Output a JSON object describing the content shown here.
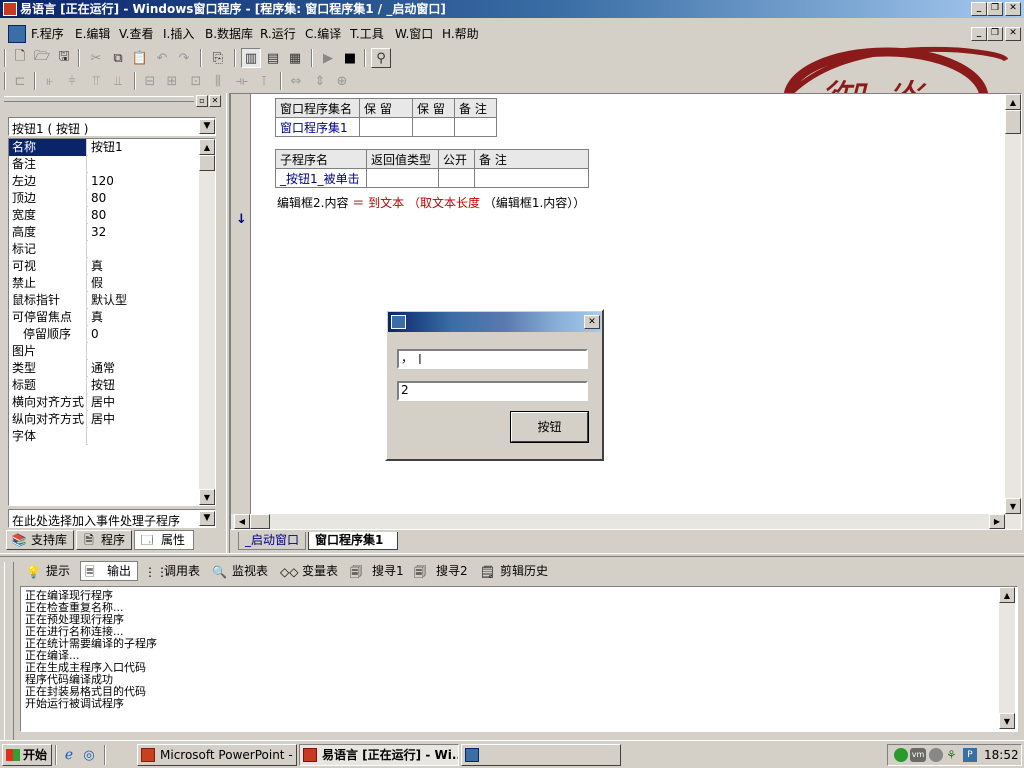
{
  "window": {
    "title": "易语言 [正在运行] - Windows窗口程序 - [程序集: 窗口程序集1 / _启动窗口]"
  },
  "menu": [
    {
      "key": "F",
      "label": "F.程序"
    },
    {
      "key": "E",
      "label": "E.编辑"
    },
    {
      "key": "V",
      "label": "V.查看"
    },
    {
      "key": "I",
      "label": "I.插入"
    },
    {
      "key": "B",
      "label": "B.数据库"
    },
    {
      "key": "R",
      "label": "R.运行"
    },
    {
      "key": "C",
      "label": "C.编译"
    },
    {
      "key": "T",
      "label": "T.工具"
    },
    {
      "key": "W",
      "label": "W.窗口"
    },
    {
      "key": "H",
      "label": "H.帮助"
    }
  ],
  "logo": {
    "text": "御焱",
    "color": "#8b1a1a"
  },
  "properties": {
    "selector": "按钮1 ( 按钮 )",
    "rows": [
      {
        "name": "名称",
        "value": "按钮1"
      },
      {
        "name": "备注",
        "value": ""
      },
      {
        "name": "左边",
        "value": "120"
      },
      {
        "name": "顶边",
        "value": "80"
      },
      {
        "name": "宽度",
        "value": "80"
      },
      {
        "name": "高度",
        "value": "32"
      },
      {
        "name": "标记",
        "value": ""
      },
      {
        "name": "可视",
        "value": "真"
      },
      {
        "name": "禁止",
        "value": "假"
      },
      {
        "name": "鼠标指针",
        "value": "默认型"
      },
      {
        "name": "可停留焦点",
        "value": "真"
      },
      {
        "name": "停留顺序",
        "value": "0"
      },
      {
        "name": "图片",
        "value": ""
      },
      {
        "name": "类型",
        "value": "通常"
      },
      {
        "name": "标题",
        "value": "按钮"
      },
      {
        "name": "横向对齐方式",
        "value": "居中"
      },
      {
        "name": "纵向对齐方式",
        "value": "居中"
      },
      {
        "name": "字体",
        "value": ""
      }
    ],
    "event_selector": "在此处选择加入事件处理子程序"
  },
  "left_tabs": [
    "支持库",
    "程序",
    "属性"
  ],
  "code": {
    "assembly_headers": [
      "窗口程序集名",
      "保 留",
      "保 留",
      "备 注"
    ],
    "assembly_row": [
      "窗口程序集1",
      "",
      "",
      ""
    ],
    "sub_headers": [
      "子程序名",
      "返回值类型",
      "公开",
      "备 注"
    ],
    "sub_row": [
      "_按钮1_被单击",
      "",
      "",
      ""
    ],
    "statement": {
      "target": "编辑框2.内容",
      "op": "＝",
      "func": "到文本",
      "open": "（",
      "inner": "取文本长度",
      "arg": "（编辑框1.内容））"
    }
  },
  "editor_tabs": [
    "_启动窗口",
    "窗口程序集1"
  ],
  "runtime_dialog": {
    "edit1_value": "，",
    "edit2_value": "2",
    "button_label": "按钮"
  },
  "output_tabs": [
    "提示",
    "输出",
    "调用表",
    "监视表",
    "变量表",
    "搜寻1",
    "搜寻2",
    "剪辑历史"
  ],
  "output_lines": [
    "正在编译现行程序",
    "正在检查重复名称...",
    "正在预处理现行程序",
    "正在进行名称连接...",
    "正在统计需要编译的子程序",
    "正在编译...",
    "正在生成主程序入口代码",
    "程序代码编译成功",
    "正在封装易格式目的代码",
    "开始运行被调试程序"
  ],
  "taskbar": {
    "start": "开始",
    "tasks": [
      "Microsoft PowerPoint - [...",
      "易语言 [正在运行] - Wi...",
      ""
    ],
    "clock": "18:52"
  }
}
